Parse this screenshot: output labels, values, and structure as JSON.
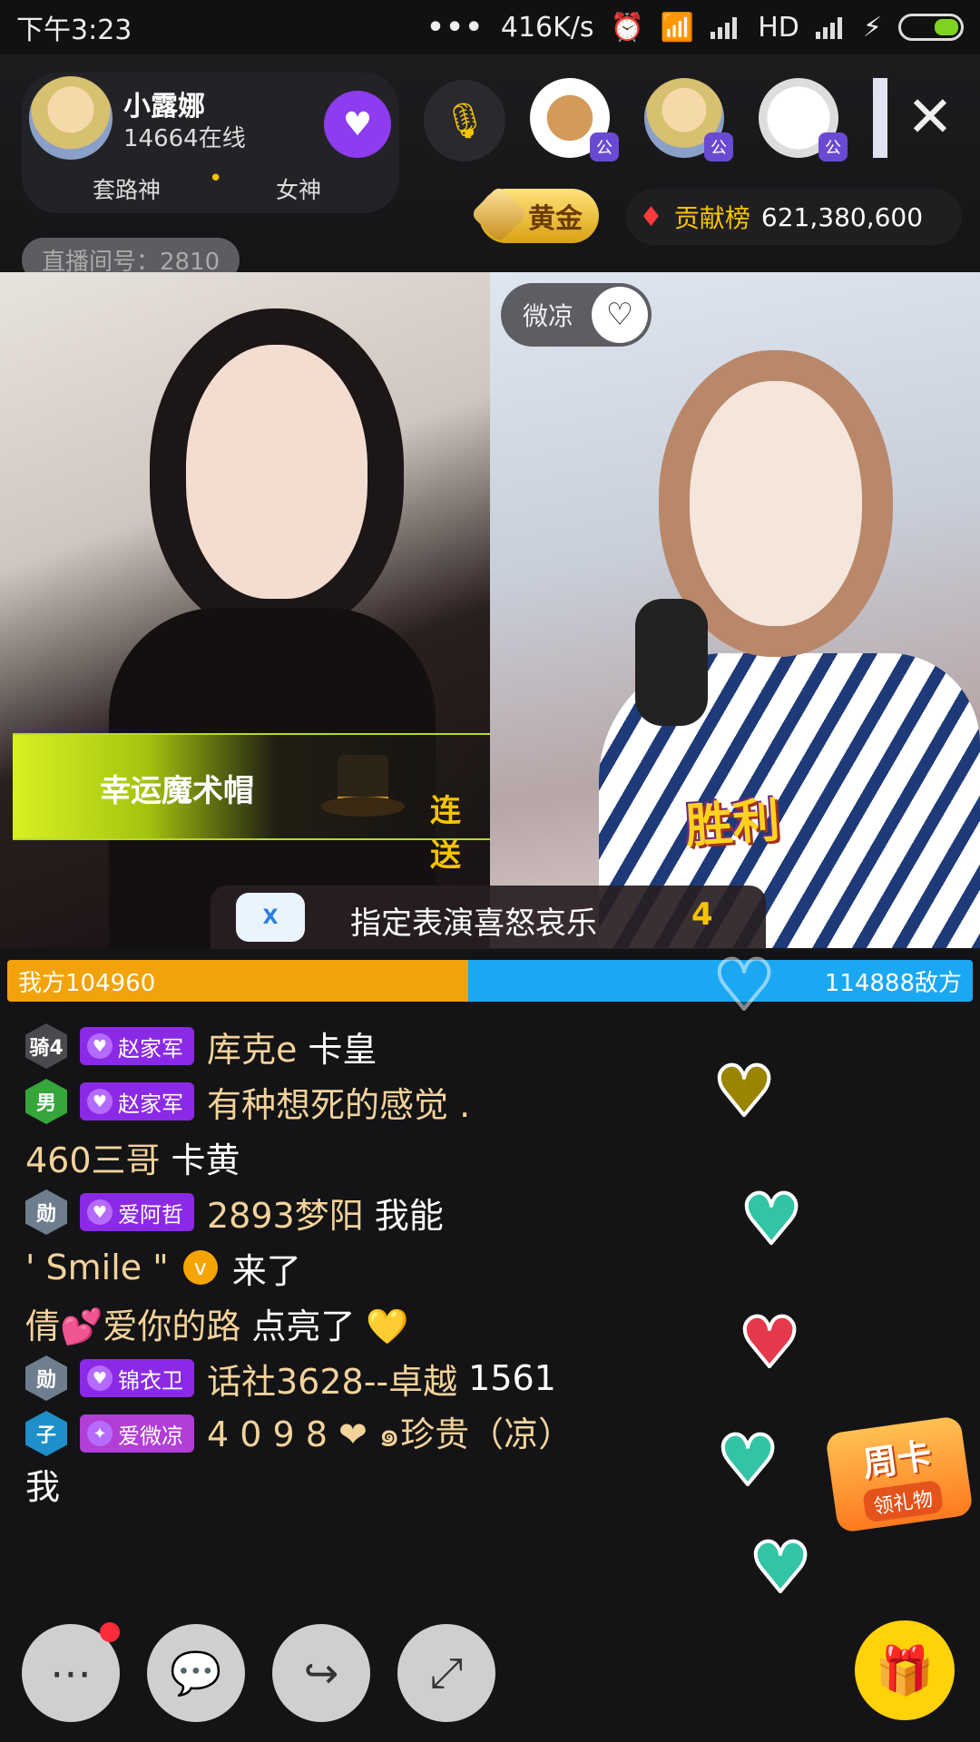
{
  "status_bar": {
    "time": "下午3:23",
    "dots": "•••",
    "speed": "416K/s",
    "network": "HD"
  },
  "anchor": {
    "name": "小露娜",
    "online": "14664在线",
    "tag1": "套路神",
    "tag_sep": "•",
    "tag2": "女神"
  },
  "header": {
    "gold_label": "黄金",
    "contrib_label": "贡献榜",
    "contrib_value": "621,380,600",
    "room_id": "直播间号：2810",
    "viewer_badge": "公"
  },
  "video": {
    "partner_name": "微凉",
    "gift_name": "幸运魔术帽",
    "combo_label": "连送",
    "win_label": "胜利",
    "task_logo": "X",
    "task_text": "指定表演喜怒哀乐",
    "task_count": "4"
  },
  "pk": {
    "left_label": "我方104960",
    "right_label": "114888敌方",
    "left_value": 104960,
    "right_value": 114888
  },
  "chat": [
    {
      "level": "骑4",
      "fan": "赵家军",
      "user": "库克e",
      "text": "卡皇"
    },
    {
      "level": "男",
      "fan": "赵家军",
      "user": "有种想死的感觉 .",
      "text": ""
    },
    {
      "level": "",
      "fan": "",
      "user": "460三哥",
      "text": "卡黄"
    },
    {
      "level": "勋",
      "fan": "爱阿哲",
      "user": "2893梦阳",
      "text": "我能"
    },
    {
      "level": "",
      "fan": "",
      "user": "' Smile \"",
      "badge": "v",
      "text": "来了"
    },
    {
      "level": "",
      "fan": "",
      "user": "倩💕爱你的路",
      "text": "点亮了 💛"
    },
    {
      "level": "勋",
      "fan": "锦衣卫",
      "user": "话社3628--卓越",
      "text": "1561"
    },
    {
      "level": "子",
      "fan": "爱微凉",
      "user": "4 0 9 8 ❤ ๑珍贵（凉）",
      "text": ""
    },
    {
      "level": "",
      "fan": "",
      "user": "我",
      "text": ""
    }
  ],
  "weekly_card": {
    "title": "周卡",
    "subtitle": "领礼物"
  },
  "colors": {
    "pk_left": "#f2a20a",
    "pk_right": "#1ba8f2",
    "accent": "#ffd20a",
    "fan_badge": "#8b2ae6"
  },
  "toolbar": {
    "more_icon": "more-icon",
    "comment_icon": "comment-icon",
    "share_icon": "share-icon",
    "fullscreen_icon": "fullscreen-icon",
    "gift_icon": "gift-icon"
  }
}
